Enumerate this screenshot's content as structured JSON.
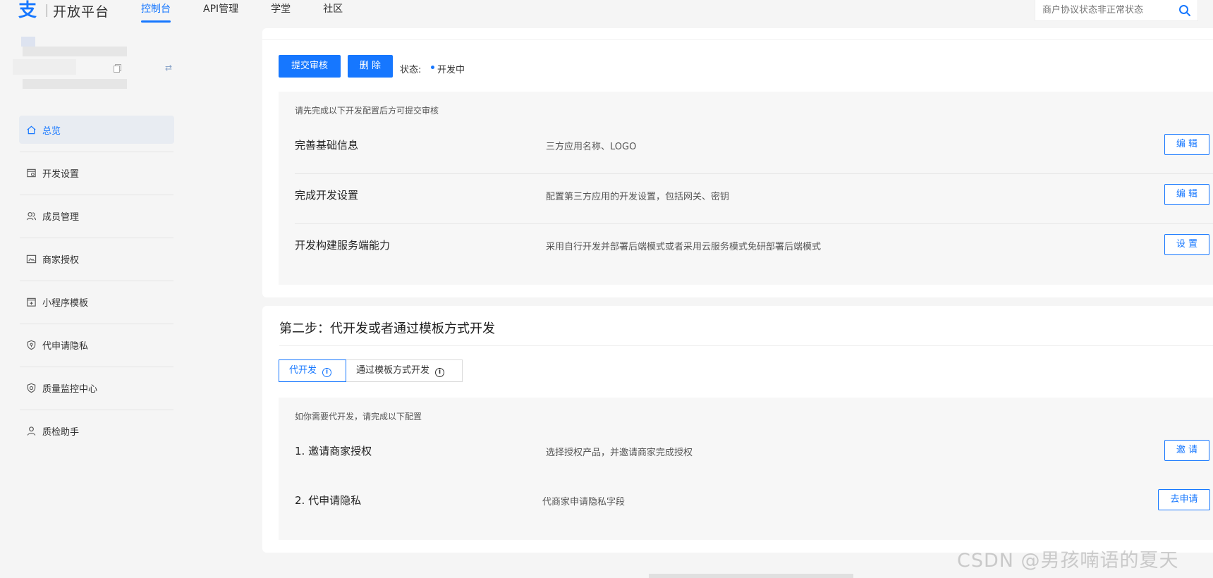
{
  "header": {
    "logo_text": "开放平台",
    "nav": [
      {
        "label": "控制台",
        "active": true
      },
      {
        "label": "API管理",
        "active": false
      },
      {
        "label": "学堂",
        "active": false
      },
      {
        "label": "社区",
        "active": false
      }
    ],
    "search_placeholder": "商户协议状态非正常状态"
  },
  "sidebar": {
    "items": [
      {
        "label": "总览",
        "icon": "home-icon",
        "active": true
      },
      {
        "label": "开发设置",
        "icon": "dev-settings-icon",
        "active": false
      },
      {
        "label": "成员管理",
        "icon": "members-icon",
        "active": false
      },
      {
        "label": "商家授权",
        "icon": "merchant-auth-icon",
        "active": false
      },
      {
        "label": "小程序模板",
        "icon": "template-icon",
        "active": false
      },
      {
        "label": "代申请隐私",
        "icon": "privacy-shield-icon",
        "active": false
      },
      {
        "label": "质量监控中心",
        "icon": "quality-monitor-icon",
        "active": false
      },
      {
        "label": "质检助手",
        "icon": "user-icon",
        "active": false
      }
    ]
  },
  "step1": {
    "submit_label": "提交审核",
    "delete_label": "删 除",
    "status_label": "状态:",
    "status_value": "开发中",
    "tip": "请先完成以下开发配置后方可提交审核",
    "rows": [
      {
        "title": "完善基础信息",
        "desc": "三方应用名称、LOGO",
        "action": "编 辑"
      },
      {
        "title": "完成开发设置",
        "desc": "配置第三方应用的开发设置，包括网关、密钥",
        "action": "编 辑"
      },
      {
        "title": "开发构建服务端能力",
        "desc": "采用自行开发并部署后端模式或者采用云服务模式免研部署后端模式",
        "action": "设 置"
      }
    ]
  },
  "step2": {
    "title": "第二步：代开发或者通过模板方式开发",
    "tabs": [
      {
        "label": "代开发",
        "active": true
      },
      {
        "label": "通过模板方式开发",
        "active": false
      }
    ],
    "tip": "如你需要代开发，请完成以下配置",
    "rows": [
      {
        "title": "1. 邀请商家授权",
        "desc": "选择授权产品，并邀请商家完成授权",
        "action": "邀 请"
      },
      {
        "title": "2. 代申请隐私",
        "desc": "代商家申请隐私字段",
        "action": "去申请"
      }
    ]
  },
  "watermark": "CSDN @男孩喃语的夏天",
  "colors": {
    "accent": "#1677ff",
    "background": "#f5f5f5",
    "panel": "#f7f7f7"
  }
}
